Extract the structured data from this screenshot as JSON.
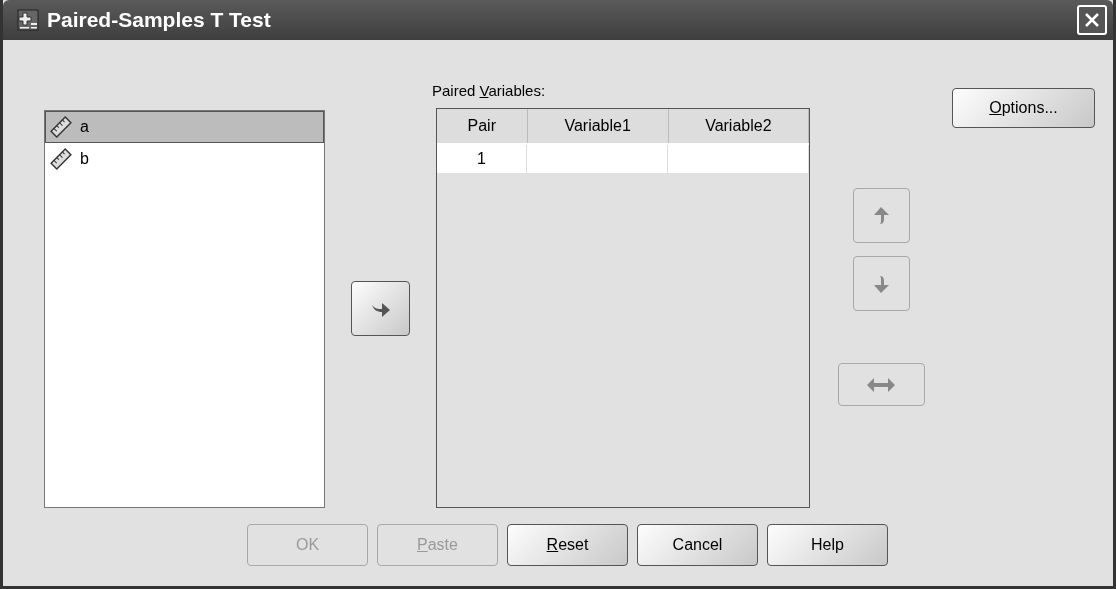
{
  "window": {
    "title": "Paired-Samples T Test"
  },
  "variables": [
    {
      "name": "a",
      "selected": true
    },
    {
      "name": "b",
      "selected": false
    }
  ],
  "move_button": {
    "disabled": false
  },
  "paired_variables": {
    "label": {
      "before": "Paired ",
      "key": "V",
      "after": "ariables:"
    },
    "columns": [
      "Pair",
      "Variable1",
      "Variable2"
    ],
    "rows": [
      {
        "pair": "1"
      }
    ]
  },
  "reorder_buttons": [
    {
      "kind": "up",
      "disabled": true
    },
    {
      "kind": "down",
      "disabled": true
    },
    {
      "kind": "swap",
      "disabled": true
    }
  ],
  "options_button": {
    "label": {
      "key": "O",
      "after": "ptions..."
    },
    "disabled": false
  },
  "buttons": [
    {
      "label": {
        "before": "OK"
      },
      "disabled": true
    },
    {
      "label": {
        "key": "P",
        "after": "aste"
      },
      "disabled": true
    },
    {
      "label": {
        "key": "R",
        "after": "eset"
      },
      "disabled": false
    },
    {
      "label": {
        "before": "Cancel"
      },
      "disabled": false
    },
    {
      "label": {
        "before": "Help"
      },
      "disabled": false
    }
  ]
}
